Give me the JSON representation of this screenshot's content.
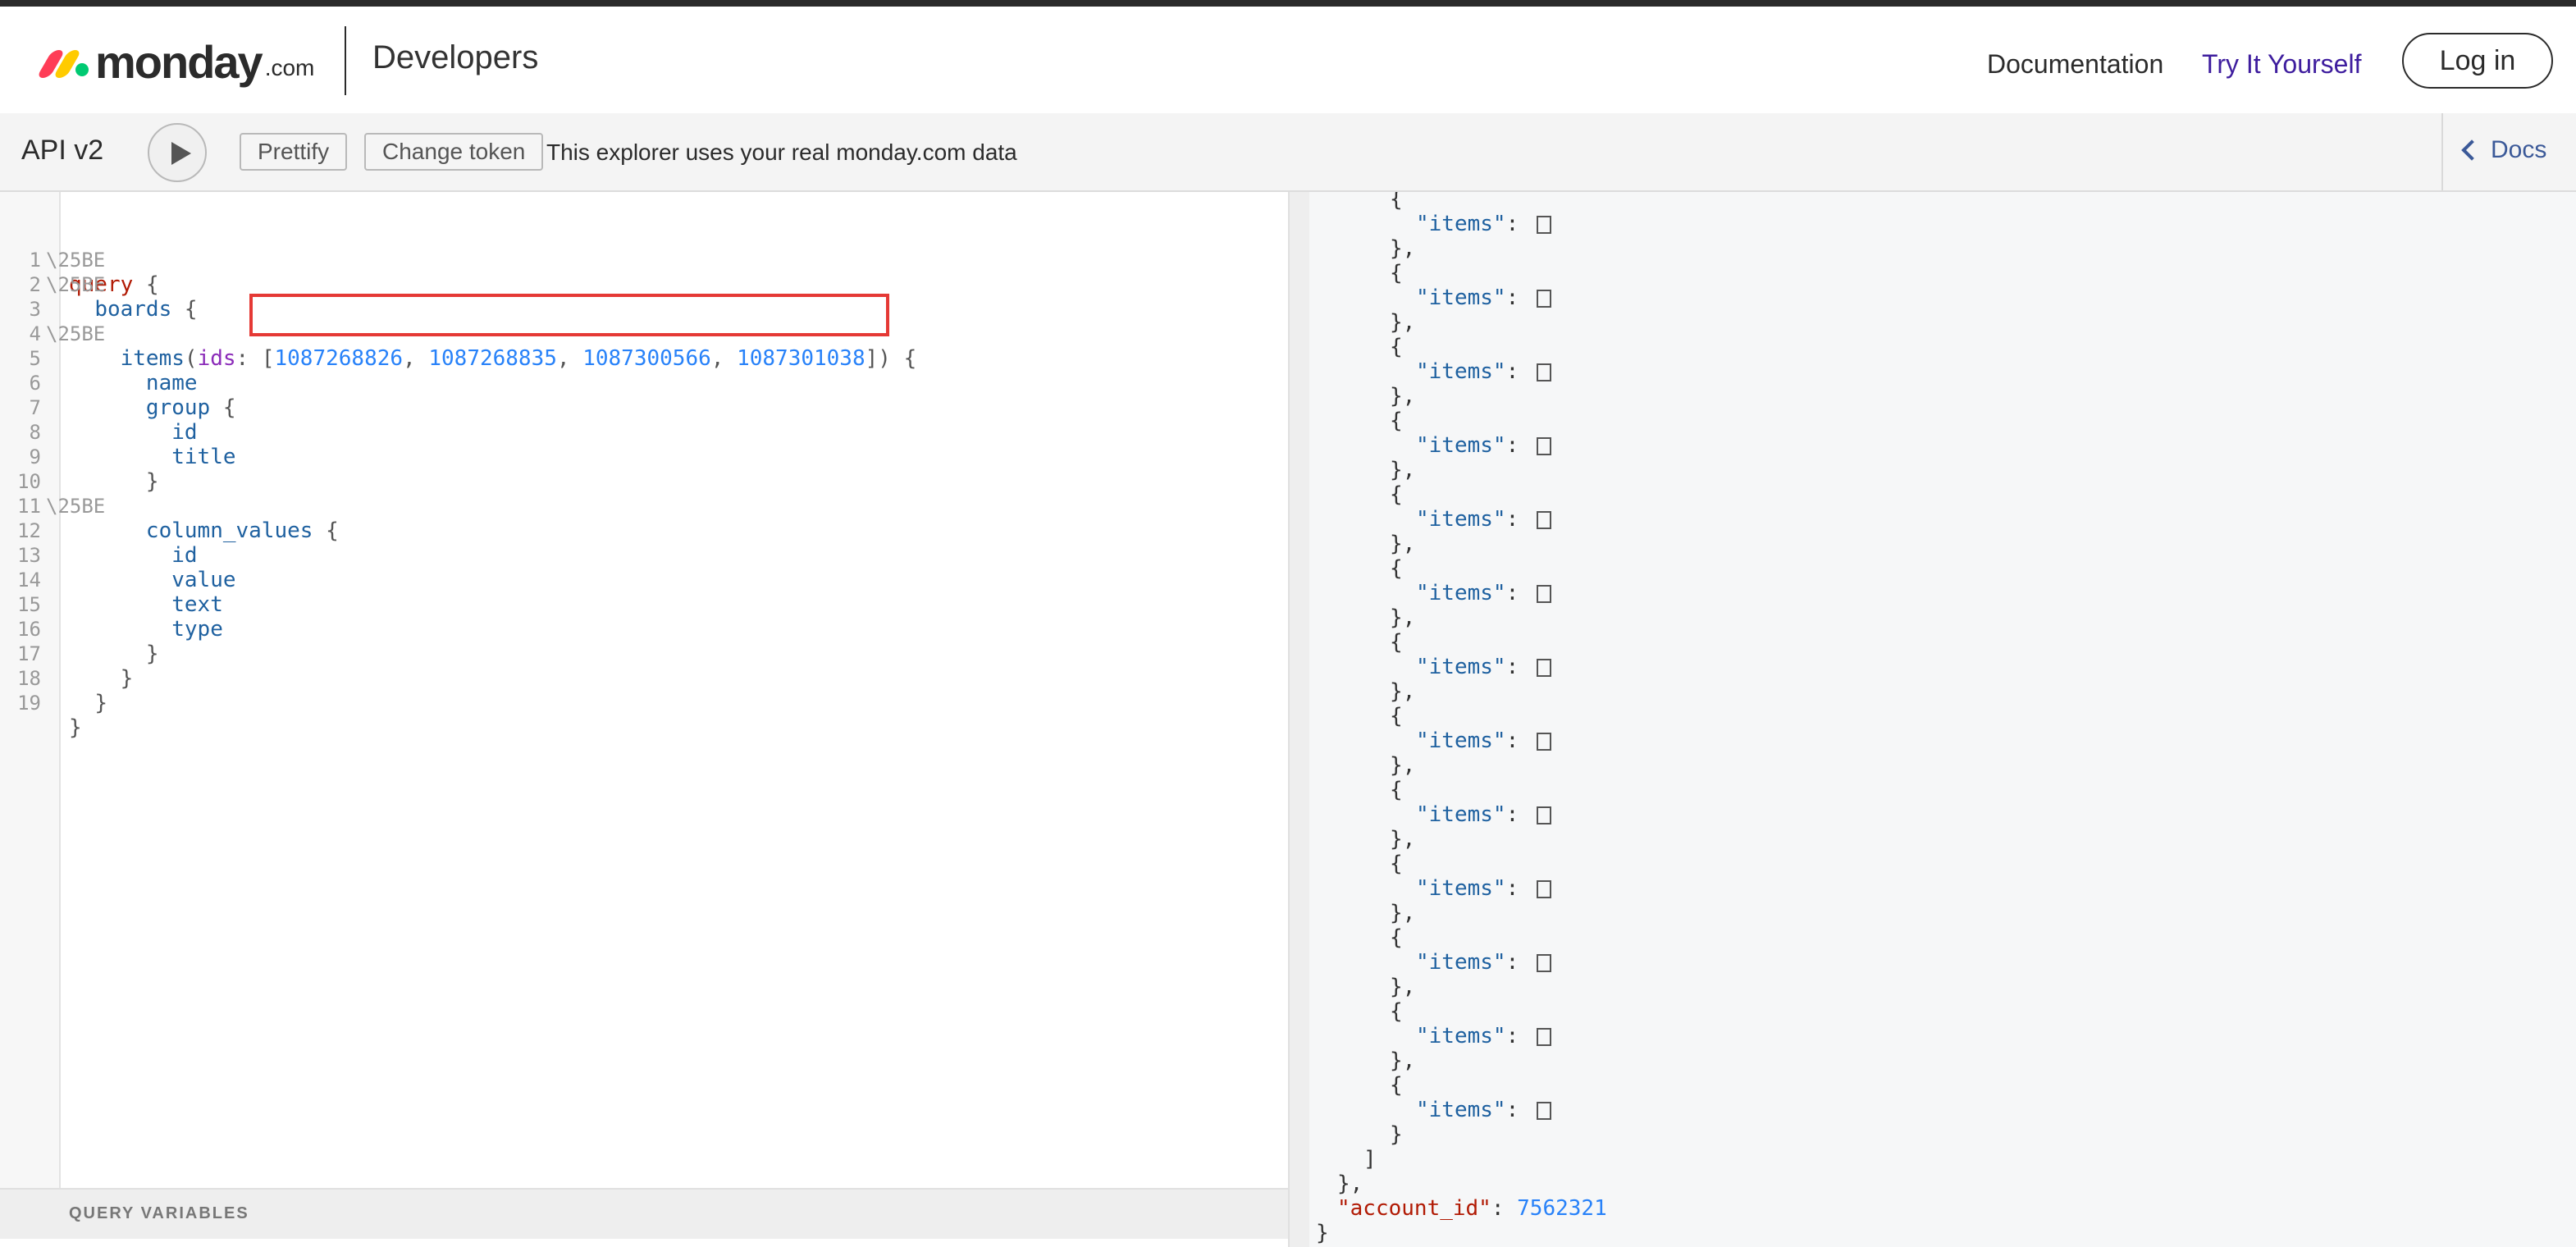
{
  "header": {
    "logo_word": "monday",
    "logo_suffix": ".com",
    "section": "Developers",
    "nav": {
      "documentation": "Documentation",
      "try": "Try It Yourself",
      "login": "Log in"
    }
  },
  "toolbar": {
    "title": "API v2",
    "prettify": "Prettify",
    "change_token": "Change token",
    "note": "This explorer uses your real monday.com data",
    "docs": "Docs"
  },
  "editor": {
    "line_numbers": [
      "1",
      "2",
      "3",
      "4",
      "5",
      "6",
      "7",
      "8",
      "9",
      "10",
      "11",
      "12",
      "13",
      "14",
      "15",
      "16",
      "17",
      "18",
      "19"
    ],
    "fold_marker": "\\25BE",
    "query_kw": "query",
    "boards": "boards",
    "items": "items",
    "ids_arg": "ids",
    "ids": [
      "1087268826",
      "1087268835",
      "1087300566",
      "1087301038"
    ],
    "name": "name",
    "group": "group",
    "id": "id",
    "title": "title",
    "column_values": "column_values",
    "value": "value",
    "text": "text",
    "type": "type"
  },
  "query_variables_label": "QUERY VARIABLES",
  "result": {
    "items_key": "\"items\"",
    "account_id_key": "\"account_id\"",
    "account_id": "7562321"
  }
}
